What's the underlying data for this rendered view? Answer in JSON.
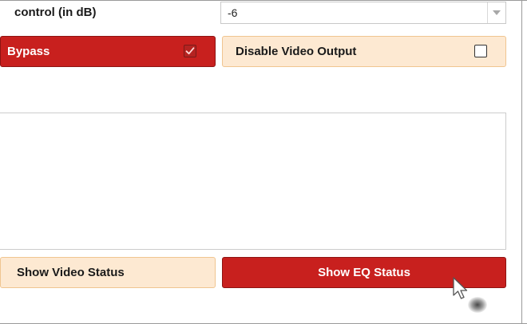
{
  "control": {
    "label": "control (in dB)",
    "value": "-6"
  },
  "toggles": {
    "eq_bypass_label": "Bypass",
    "eq_bypass_checked": true,
    "disable_video_label": "Disable Video Output",
    "disable_video_checked": false
  },
  "status": {
    "text": ""
  },
  "buttons": {
    "video_status_label": "Show Video Status",
    "eq_status_label": "Show EQ Status"
  },
  "colors": {
    "active_red": "#c8201e",
    "inactive_cream": "#fde9d2"
  },
  "icons": {
    "dropdown": "chevron-down-icon",
    "checked": "checkbox-checked-icon",
    "unchecked": "checkbox-unchecked-icon",
    "cursor": "mouse-pointer-icon"
  }
}
